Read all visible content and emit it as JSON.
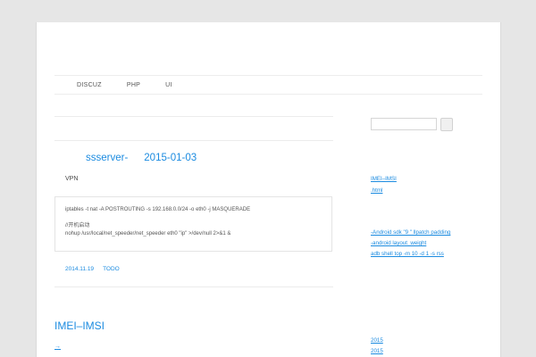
{
  "nav": {
    "items": [
      {
        "label": "DISCUZ"
      },
      {
        "label": "PHP"
      },
      {
        "label": "UI"
      }
    ]
  },
  "post": {
    "title": "ssserver-",
    "date": "2015-01-03",
    "excerpt": "VPN",
    "code_line1": "iptables -t nat -A POSTROUTING -s 192.168.0.0/24 -o eth0 -j MASQUERADE",
    "code_line2": "//开机启动",
    "code_line3": "nohup /usr/local/net_speeder/net_speeder eth0 \"ip\" >/dev/null 2>&1 &",
    "meta_date": "2014.11.19",
    "meta_tag": "TODO"
  },
  "post2": {
    "title": "IMEI–IMSI",
    "more": "→"
  },
  "sidebar": {
    "links": [
      {
        "label": "IMEI–IMSI"
      },
      {
        "label": " .html "
      },
      {
        "label": " "
      },
      {
        "label": " "
      },
      {
        "label": " -Android sdk  \"9 \" llpatch      padding"
      },
      {
        "label": " -android layout_weight      "
      },
      {
        "label": "adb shell top -m 10 -d 1 -s rss"
      }
    ],
    "archives": [
      {
        "label": "2015     "
      },
      {
        "label": "2015     "
      }
    ]
  }
}
